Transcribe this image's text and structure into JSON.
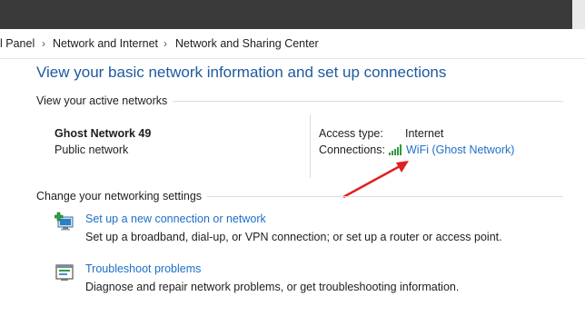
{
  "breadcrumb": {
    "items": [
      "l Panel",
      "Network and Internet",
      "Network and Sharing Center"
    ]
  },
  "page": {
    "title": "View your basic network information and set up connections"
  },
  "active_networks": {
    "header": "View your active networks",
    "name": "Ghost Network 49",
    "type": "Public network",
    "access_type_label": "Access type:",
    "access_type_value": "Internet",
    "connections_label": "Connections:",
    "connection_link": "WiFi (Ghost Network)",
    "connection_icon": "wifi-signal-icon"
  },
  "settings": {
    "header": "Change your networking settings",
    "tasks": [
      {
        "title": "Set up a new connection or network",
        "description": "Set up a broadband, dial-up, or VPN connection; or set up a router or access point.",
        "icon": "new-connection-icon"
      },
      {
        "title": "Troubleshoot problems",
        "description": "Diagnose and repair network problems, or get troubleshooting information.",
        "icon": "troubleshoot-icon"
      }
    ]
  },
  "colors": {
    "link": "#1e6fc8",
    "title": "#1e5aa0",
    "annotation_arrow": "#e02020",
    "titlebar": "#3a3a3a"
  }
}
